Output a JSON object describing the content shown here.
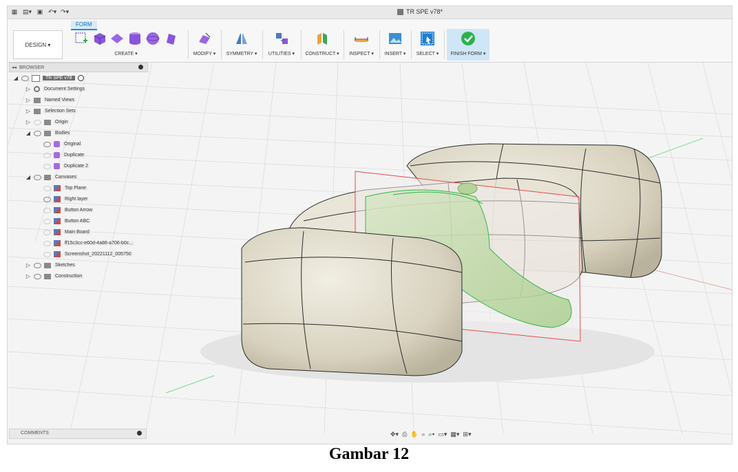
{
  "window": {
    "title": "TR SPE v78*"
  },
  "quick_access": [
    "grid-icon",
    "file-icon",
    "save-icon",
    "undo-icon",
    "redo-icon"
  ],
  "ribbon": {
    "active_tab": "FORM",
    "workspace": "DESIGN ▾",
    "groups": {
      "create": "CREATE ▾",
      "modify": "MODIFY ▾",
      "symmetry": "SYMMETRY ▾",
      "utilities": "UTILITIES ▾",
      "construct": "CONSTRUCT ▾",
      "inspect": "INSPECT ▾",
      "insert": "INSERT ▾",
      "select": "SELECT ▾",
      "finish": "FINISH FORM ▾"
    }
  },
  "browser": {
    "title": "BROWSER",
    "root": "TR SPE v78",
    "items": [
      {
        "label": "Document Settings"
      },
      {
        "label": "Named Views"
      },
      {
        "label": "Selection Sets"
      },
      {
        "label": "Origin"
      },
      {
        "label": "Bodies"
      },
      {
        "label": "Original"
      },
      {
        "label": "Duplicate"
      },
      {
        "label": "Duplicate 2"
      },
      {
        "label": "Canvases"
      },
      {
        "label": "Top Plane"
      },
      {
        "label": "Right layer"
      },
      {
        "label": "Button Arrow"
      },
      {
        "label": "Button ABC"
      },
      {
        "label": "Main Board"
      },
      {
        "label": "ff15c3cc-e60d-4a86-a706-b0c..."
      },
      {
        "label": "Screenshot_20221112_005750"
      },
      {
        "label": "Sketches"
      },
      {
        "label": "Construction"
      }
    ]
  },
  "comments": {
    "title": "COMMENTS"
  },
  "colors": {
    "accent": "#1a8ad4",
    "finish_green": "#2bb24c",
    "body": "#e1dccb",
    "body_outline": "#2a2a2a",
    "sketch_green": "#2fb84a",
    "plane_red": "#e24b4b"
  },
  "caption": "Gambar 12"
}
